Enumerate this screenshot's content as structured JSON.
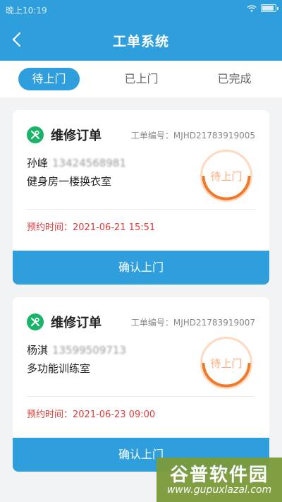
{
  "status_bar": {
    "time": "晚上10:19",
    "wifi_icon": "wifi-icon",
    "battery_icon": "battery-icon"
  },
  "header": {
    "title": "工单系统",
    "back_icon": "chevron-left-icon",
    "bg_color": "#2e9fdc"
  },
  "tabs": [
    {
      "label": "待上门",
      "active": true
    },
    {
      "label": "已上门",
      "active": false
    },
    {
      "label": "已完成",
      "active": false
    }
  ],
  "orders": [
    {
      "type": "维修订单",
      "order_no": "工单编号：MJHD21783919005",
      "name": "孙峰",
      "phone": "13424568981",
      "location": "健身房一楼换衣室",
      "status": "待上门",
      "appointment": "预约时间：2021-06-21 15:51",
      "confirm_label": "确认上门"
    },
    {
      "type": "维修订单",
      "order_no": "工单编号：MJHD21783919007",
      "name": "杨淇",
      "phone": "13599509713",
      "location": "多功能训练室",
      "status": "待上门",
      "appointment": "预约时间：2021-06-23 09:00",
      "confirm_label": "确认上门"
    }
  ],
  "watermark": {
    "title": "谷普软件园",
    "url": "www.gupuxlazal.com"
  },
  "colors": {
    "accent": "#2e9fdc",
    "status_orange": "#f07a2a",
    "time_red": "#e23b3b",
    "badge_green": "#1ab36a"
  }
}
